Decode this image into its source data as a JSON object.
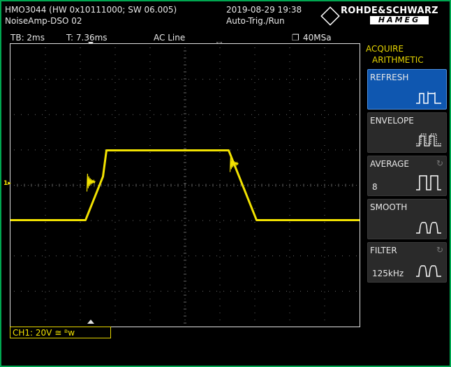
{
  "header": {
    "device_line": "HMO3044 (HW 0x10111000; SW 06.005)",
    "setup_line": "NoiseAmp-DSO 02",
    "datetime": "2019-08-29 19:38",
    "trigger_mode": "Auto-Trig./Run",
    "brand_primary": "ROHDE&SCHWARZ",
    "brand_secondary": "HAMEG"
  },
  "statusbar": {
    "timebase": "TB: 2ms",
    "trigger_time": "T: 7.36ms",
    "trigger_source": "AC Line",
    "sample_rate": "40MSa"
  },
  "channel": {
    "label": "CH1: 20V ≅ ᴮᴡ",
    "marker": "1",
    "color": "#f2e200"
  },
  "menu": {
    "title": "ACQUIRE",
    "subtitle": "ARITHMETIC",
    "items": [
      {
        "label": "REFRESH",
        "value": "",
        "active": true
      },
      {
        "label": "ENVELOPE",
        "value": "",
        "active": false
      },
      {
        "label": "AVERAGE",
        "value": "8",
        "active": false
      },
      {
        "label": "SMOOTH",
        "value": "",
        "active": false
      },
      {
        "label": "FILTER",
        "value": "125kHz",
        "active": false
      }
    ]
  },
  "chart_data": {
    "type": "line",
    "xlabel": "",
    "ylabel": "",
    "x": [
      -8.2,
      -3.9,
      -2.9,
      -2.7,
      4.3,
      5.9
    ],
    "values": [
      -1.0,
      -1.0,
      0.25,
      1.0,
      1.0,
      -1.0
    ],
    "series_name": "",
    "xlim": [
      -8.2,
      11.8
    ],
    "ylim": [
      -4.05,
      4.05
    ],
    "grid": true
  }
}
